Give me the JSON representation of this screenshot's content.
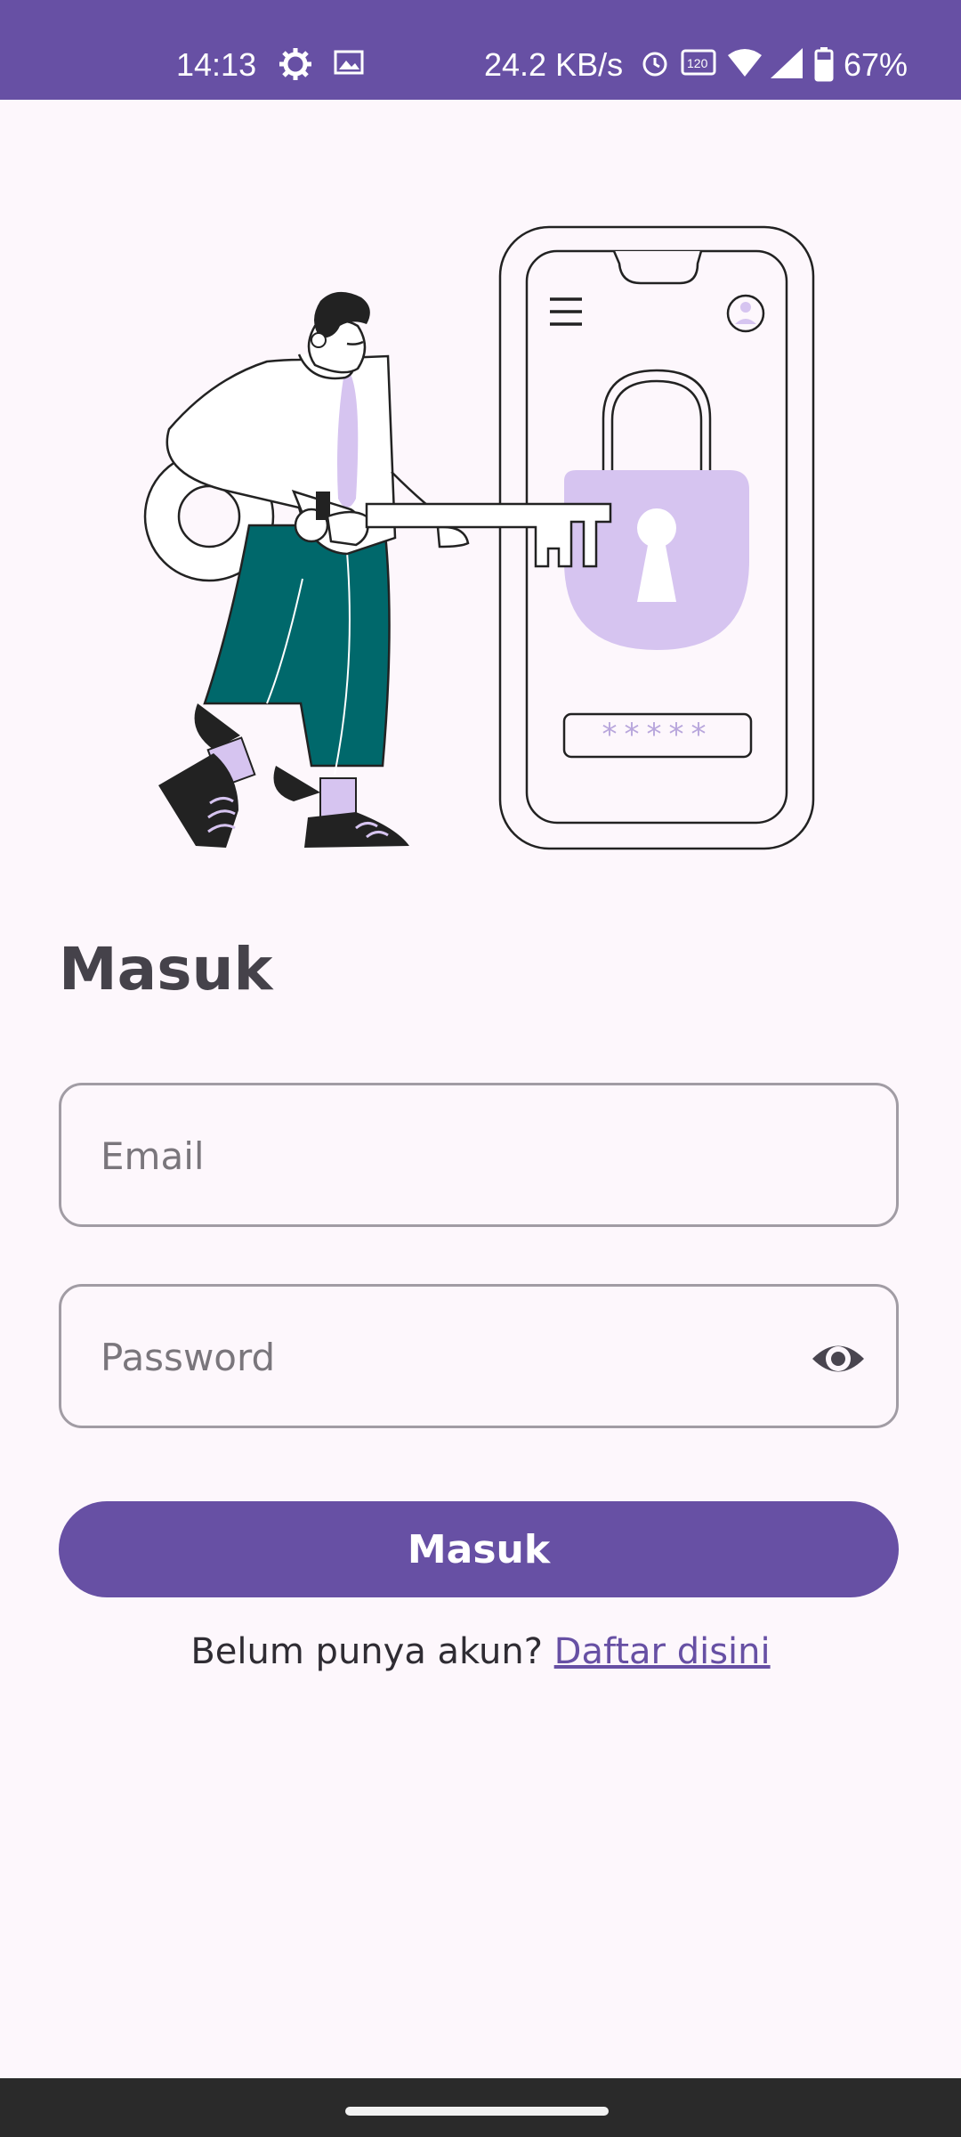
{
  "status_bar": {
    "time": "14:13",
    "network_speed": "24.2 KB/s",
    "battery": "67%",
    "icons": [
      "settings-gear-icon",
      "image-icon",
      "alarm-icon",
      "refresh-rate-120hz-icon",
      "wifi-icon",
      "cellular-signal-icon",
      "battery-icon"
    ]
  },
  "illustration": {
    "password_mask": "*****",
    "icons": [
      "menu-icon",
      "profile-icon",
      "padlock-icon",
      "key-icon"
    ]
  },
  "login": {
    "title": "Masuk",
    "email_placeholder": "Email",
    "password_placeholder": "Password",
    "submit_label": "Masuk",
    "register_prompt": "Belum punya akun?",
    "register_link": "Daftar disini"
  },
  "colors": {
    "primary": "#6750a4",
    "background": "#fdf7fc",
    "lock_fill": "#d6c4f0",
    "pants": "#00686b"
  }
}
